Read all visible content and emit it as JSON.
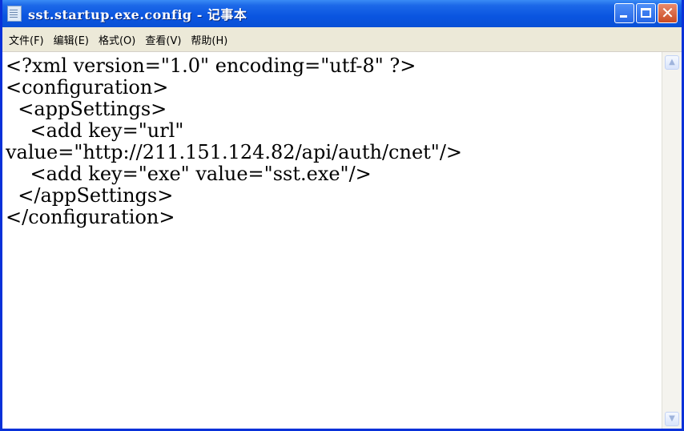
{
  "window": {
    "title": "sst.startup.exe.config - 记事本",
    "icon": "notepad-icon"
  },
  "titlebar_buttons": {
    "minimize": "minimize-icon",
    "maximize": "maximize-icon",
    "close_glyph": "✕"
  },
  "menu": {
    "items": [
      {
        "label": "文件(F)"
      },
      {
        "label": "编辑(E)"
      },
      {
        "label": "格式(O)"
      },
      {
        "label": "查看(V)"
      },
      {
        "label": "帮助(H)"
      }
    ]
  },
  "document": {
    "lines": [
      "<?xml version=\"1.0\" encoding=\"utf-8\" ?>",
      "<configuration>",
      "  <appSettings>",
      "    <add key=\"url\"",
      "value=\"http://211.151.124.82/api/auth/cnet\"/>",
      "    <add key=\"exe\" value=\"sst.exe\"/>",
      "  </appSettings>",
      "</configuration>"
    ]
  },
  "scrollbar": {
    "up_arrow": "▲",
    "down_arrow": "▼"
  },
  "colors": {
    "titlebar": "#0a55e0",
    "menubar": "#ece9d8",
    "close_button": "#c94b24"
  }
}
